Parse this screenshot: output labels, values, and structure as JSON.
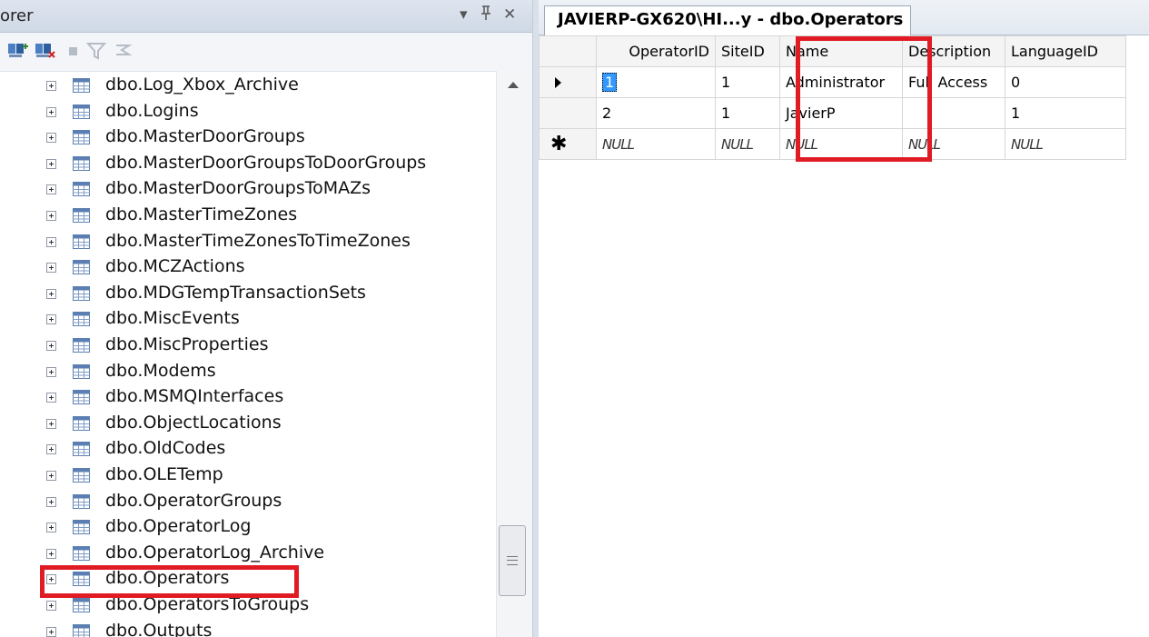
{
  "explorer": {
    "title": "orer",
    "title_buttons": [
      "▾",
      "ᴨ",
      "✕"
    ],
    "toolbar_icons": [
      "connect-icon",
      "disconnect-icon",
      "stop-icon",
      "filter-icon",
      "refresh-icon"
    ],
    "items": [
      {
        "label": "dbo.Log_Xbox_Archive"
      },
      {
        "label": "dbo.Logins"
      },
      {
        "label": "dbo.MasterDoorGroups"
      },
      {
        "label": "dbo.MasterDoorGroupsToDoorGroups"
      },
      {
        "label": "dbo.MasterDoorGroupsToMAZs"
      },
      {
        "label": "dbo.MasterTimeZones"
      },
      {
        "label": "dbo.MasterTimeZonesToTimeZones"
      },
      {
        "label": "dbo.MCZActions"
      },
      {
        "label": "dbo.MDGTempTransactionSets"
      },
      {
        "label": "dbo.MiscEvents"
      },
      {
        "label": "dbo.MiscProperties"
      },
      {
        "label": "dbo.Modems"
      },
      {
        "label": "dbo.MSMQInterfaces"
      },
      {
        "label": "dbo.ObjectLocations"
      },
      {
        "label": "dbo.OldCodes"
      },
      {
        "label": "dbo.OLETemp"
      },
      {
        "label": "dbo.OperatorGroups"
      },
      {
        "label": "dbo.OperatorLog"
      },
      {
        "label": "dbo.OperatorLog_Archive"
      },
      {
        "label": "dbo.Operators"
      },
      {
        "label": "dbo.OperatorsToGroups"
      },
      {
        "label": "dbo.Outputs"
      }
    ]
  },
  "document": {
    "tab_label": "JAVIERP-GX620\\HI...y - dbo.Operators",
    "columns": [
      "OperatorID",
      "SiteID",
      "Name",
      "Description",
      "LanguageID"
    ],
    "rows": [
      {
        "OperatorID": "1",
        "SiteID": "1",
        "Name": "Administrator",
        "Description": "Full Access",
        "LanguageID": "0"
      },
      {
        "OperatorID": "2",
        "SiteID": "1",
        "Name": "JavierP",
        "Description": "",
        "LanguageID": "1"
      },
      {
        "OperatorID": "NULL",
        "SiteID": "NULL",
        "Name": "NULL",
        "Description": "NULL",
        "LanguageID": "NULL"
      }
    ]
  },
  "colors": {
    "highlight": "#e01b24",
    "selection": "#3399ff"
  }
}
